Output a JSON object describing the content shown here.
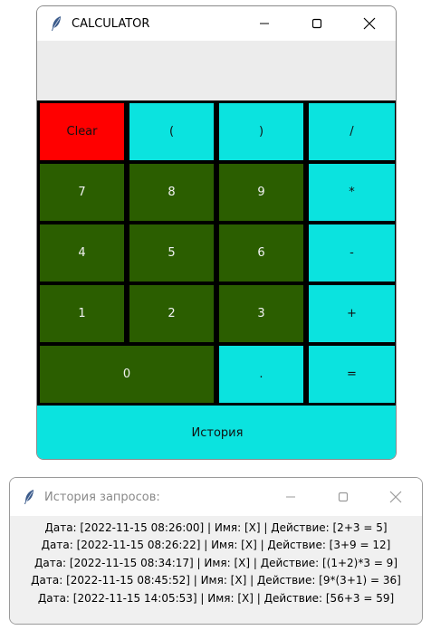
{
  "calculator": {
    "title": "CALCULATOR",
    "display_value": "",
    "buttons": {
      "clear": "Clear",
      "lparen": "(",
      "rparen": ")",
      "divide": "/",
      "d7": "7",
      "d8": "8",
      "d9": "9",
      "multiply": "*",
      "d4": "4",
      "d5": "5",
      "d6": "6",
      "minus": "-",
      "d1": "1",
      "d2": "2",
      "d3": "3",
      "plus": "+",
      "d0": "0",
      "dot": ".",
      "equals": "=",
      "history": "История"
    },
    "colors": {
      "operator": "#0be3df",
      "digit": "#2b5e00",
      "clear": "#ff0000"
    }
  },
  "history_window": {
    "title": "История запросов:",
    "entries": [
      "Дата: [2022-11-15 08:26:00] | Имя: [X] | Действие: [2+3 = 5]",
      "Дата: [2022-11-15 08:26:22] | Имя: [X] | Действие: [3+9 = 12]",
      "Дата: [2022-11-15 08:34:17] | Имя: [X] | Действие: [(1+2)*3 = 9]",
      "Дата: [2022-11-15 08:45:52] | Имя: [X] | Действие: [9*(3+1) = 36]",
      "Дата: [2022-11-15 14:05:53] | Имя: [X] | Действие: [56+3 = 59]"
    ]
  }
}
